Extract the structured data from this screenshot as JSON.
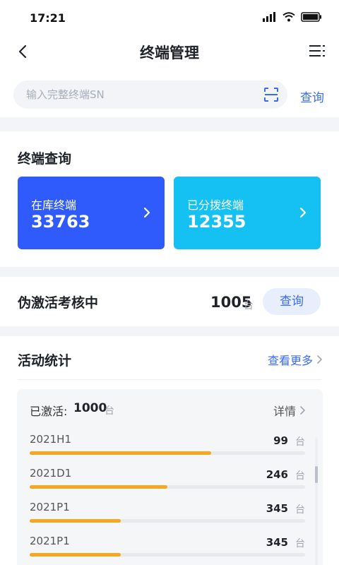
{
  "status": {
    "time": "17:21"
  },
  "nav": {
    "title": "终端管理"
  },
  "search": {
    "placeholder": "输入完整终端SN",
    "button_label": "查询"
  },
  "terminal_query": {
    "title": "终端查询",
    "cards": [
      {
        "label": "在库终端",
        "value": "33763",
        "color": "#2f5bfc"
      },
      {
        "label": "已分拨终端",
        "value": "12355",
        "color": "#14c1f2"
      }
    ]
  },
  "pseudo_activation": {
    "title": "伪激活考核中",
    "count": "1005",
    "unit": "台",
    "button_label": "查询"
  },
  "activity": {
    "title": "活动统计",
    "more_label": "查看更多",
    "activated_label": "已激活:",
    "activated_value": "1000",
    "activated_unit": "台",
    "detail_label": "详情",
    "rows": [
      {
        "name": "2021H1",
        "count": "99",
        "unit": "台",
        "progress": 0.66
      },
      {
        "name": "2021D1",
        "count": "246",
        "unit": "台",
        "progress": 0.5
      },
      {
        "name": "2021P1",
        "count": "345",
        "unit": "台",
        "progress": 0.33
      },
      {
        "name": "2021P1",
        "count": "345",
        "unit": "台",
        "progress": 0.33
      }
    ]
  },
  "colors": {
    "accent": "#3a6cf0",
    "progress": "#f6a623"
  }
}
